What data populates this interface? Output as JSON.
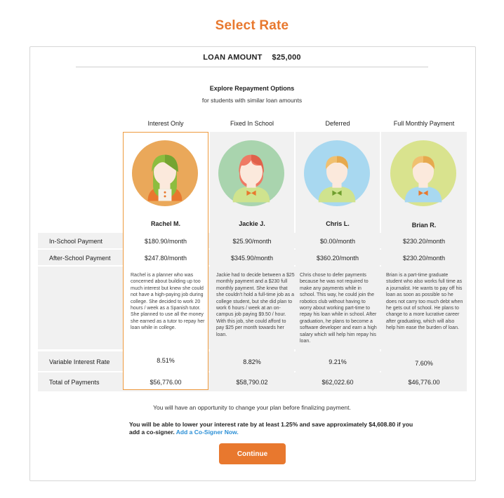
{
  "page": {
    "title": "Select Rate"
  },
  "loan": {
    "label": "LOAN AMOUNT",
    "value": "$25,000"
  },
  "explore": {
    "title": "Explore Repayment Options",
    "subtitle": "for students with similar loan amounts"
  },
  "row_labels": {
    "in_school": "In-School Payment",
    "after_school": "After-School Payment",
    "rate": "Variable Interest Rate",
    "total": "Total of Payments"
  },
  "plans": [
    {
      "header": "Interest Only",
      "name": "Rachel M.",
      "in_school": "$180.90/month",
      "after_school": "$247.80/month",
      "description": "Rachel is a planner who was concerned about building up too much interest but knew she could not have a high-paying job during college. She decided to work 20 hours / week as a Spanish tutor. She planned to use all the money she earned as a tutor to repay her loan while in college.",
      "rate": "8.51%",
      "total": "$56,776.00",
      "selected": true,
      "avatar_icon": "girl-avatar-icon",
      "colors": {
        "circle": "#eaa85a",
        "hair": "#8cbd3f",
        "shirt": "#e8782e"
      }
    },
    {
      "header": "Fixed In School",
      "name": "Jackie J.",
      "in_school": "$25.90/month",
      "after_school": "$345.90/month",
      "description": "Jackie had to decide between a $25 monthly payment and a $230 full monthly payment. She knew that she couldn't hold a full-time job as a college student, but she did plan to work 6 hours / week at an on-campus job paying $9.50 / hour. With this job, she could afford to pay $25 per month towards her loan.",
      "rate": "8.82%",
      "total": "$58,790.02",
      "selected": false,
      "avatar_icon": "girl-avatar-icon",
      "colors": {
        "circle": "#a9d4ae",
        "hair": "#ef7a64",
        "shirt": "#cfe38e"
      }
    },
    {
      "header": "Deferred",
      "name": "Chris L.",
      "in_school": "$0.00/month",
      "after_school": "$360.20/month",
      "description": "Chris chose to defer payments because he was not required to make any payments while in school. This way, he could join the robotics club without having to worry about working part-time to repay his loan while in school. After graduation, he plans to become a software developer and earn a high salary which will help him repay his loan.",
      "rate": "9.21%",
      "total": "$62,022.60",
      "selected": false,
      "avatar_icon": "boy-avatar-icon",
      "colors": {
        "circle": "#a8d8f0",
        "hair": "#f0c070",
        "shirt": "#cfe38e"
      }
    },
    {
      "header": "Full Monthly Payment",
      "name": "Brian R.",
      "in_school": "$230.20/month",
      "after_school": "$230.20/month",
      "description": "Brian is a part-time graduate student who also works full time as a journalist. He wants to pay off his loan as soon as possible so he does not carry too much debt when he gets out of school. He plans to change to a more lucrative career after graduating, which will also help him ease the burden of loan.",
      "rate": "7.60%",
      "total": "$46,776.00",
      "selected": false,
      "avatar_icon": "boy-avatar-icon",
      "colors": {
        "circle": "#d9e38e",
        "hair": "#f0c070",
        "shirt": "#a8d8f0"
      }
    }
  ],
  "note": "You will have an opportunity to change your plan before finalizing payment.",
  "cosigner": {
    "text": "You will be able to lower your interest rate by at least 1.25% and save approximately $4,608.80 if you add a co-signer.",
    "link": "Add a Co-Signer Now."
  },
  "continue_label": "Continue",
  "accent_color": "#e8782e",
  "link_color": "#2b8fd6"
}
